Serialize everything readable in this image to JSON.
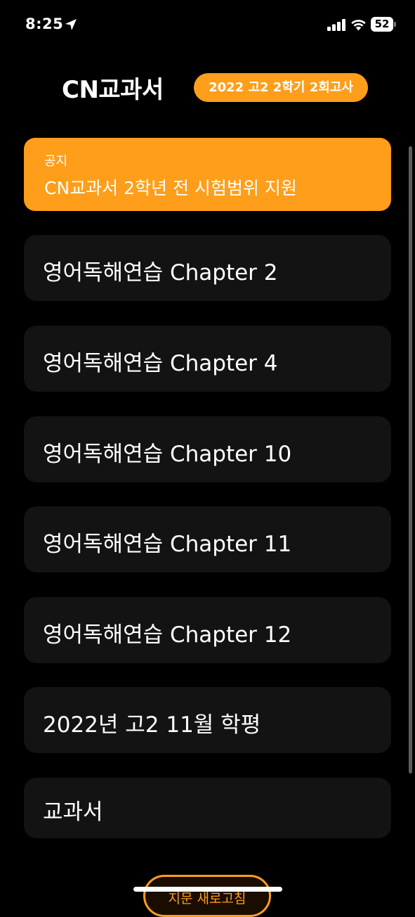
{
  "status_bar": {
    "time": "8:25",
    "battery_level": "52"
  },
  "header": {
    "title": "CN교과서",
    "exam_badge": "2022 고2 2학기 2회고사"
  },
  "notice": {
    "label": "공지",
    "text": "CN교과서 2학년 전 시험범위 지원"
  },
  "list": {
    "items": [
      {
        "label": "영어독해연습 Chapter 2"
      },
      {
        "label": "영어독해연습 Chapter 4"
      },
      {
        "label": "영어독해연습 Chapter 10"
      },
      {
        "label": "영어독해연습 Chapter 11"
      },
      {
        "label": "영어독해연습 Chapter 12"
      },
      {
        "label": "2022년 고2 11월 학평"
      },
      {
        "label": "교과서"
      }
    ]
  },
  "footer": {
    "refresh_label": "지문 새로고침"
  },
  "colors": {
    "accent": "#ff9e1a",
    "background": "#000000",
    "card": "#131313"
  }
}
